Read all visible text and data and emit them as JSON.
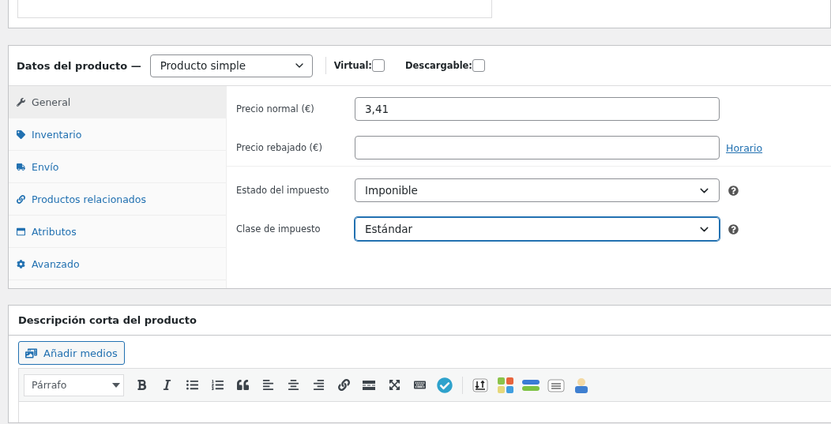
{
  "product_data": {
    "title": "Datos del producto —",
    "product_type": "Producto simple",
    "options": [
      {
        "label": "Virtual:",
        "checked": false
      },
      {
        "label": "Descargable:",
        "checked": false
      }
    ],
    "tabs": [
      {
        "label": "General",
        "selected": true
      },
      {
        "label": "Inventario",
        "selected": false
      },
      {
        "label": "Envío",
        "selected": false
      },
      {
        "label": "Productos relacionados",
        "selected": false
      },
      {
        "label": "Atributos",
        "selected": false
      },
      {
        "label": "Avanzado",
        "selected": false
      }
    ],
    "sections": [
      [
        {
          "kind": "text",
          "label": "Precio normal (€)",
          "value": "3,41"
        },
        {
          "kind": "text",
          "label": "Precio rebajado (€)",
          "link": "Horario"
        }
      ],
      [
        {
          "kind": "select",
          "label": "Estado del impuesto",
          "value": "Imponible",
          "focused": false
        },
        {
          "kind": "select",
          "label": "Clase de impuesto",
          "value": "Estándar",
          "focused": true
        }
      ]
    ]
  },
  "short_description": {
    "title": "Descripción corta del producto",
    "add_media": "Añadir medios",
    "format": "Párrafo"
  }
}
